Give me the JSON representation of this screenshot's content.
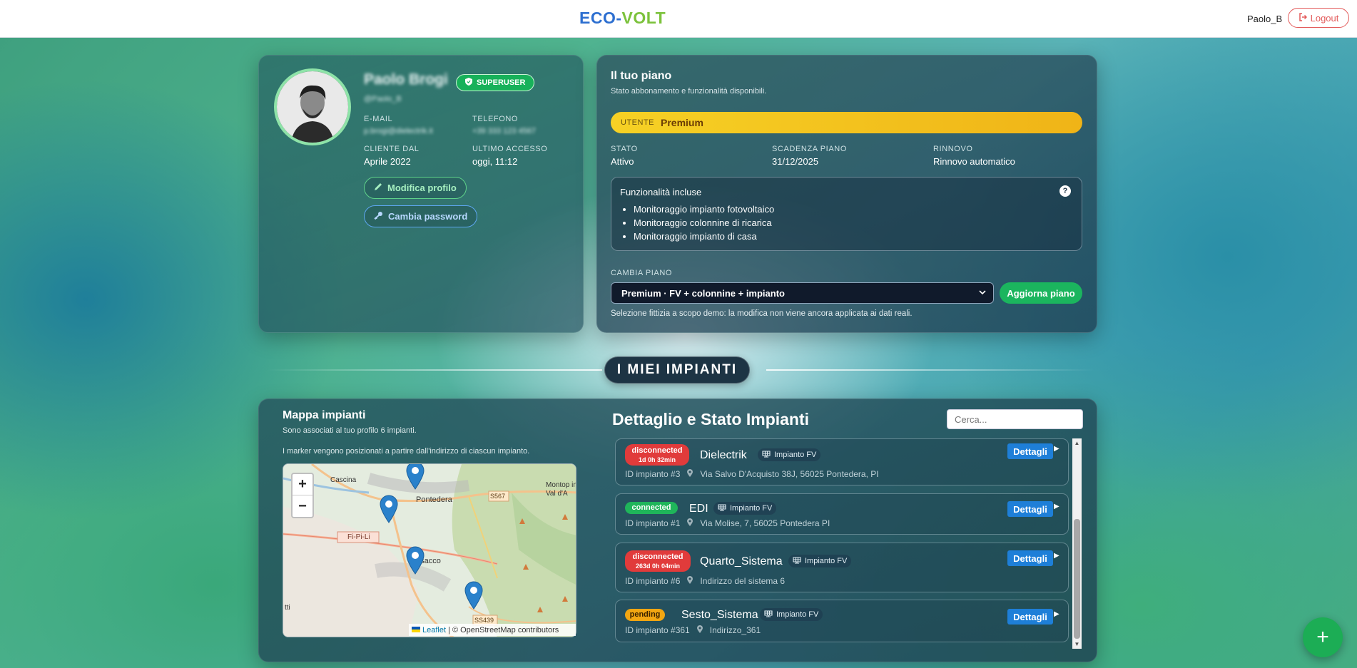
{
  "header": {
    "brand_part1": "ECO-",
    "brand_part2": "VOLT",
    "username": "Paolo_B",
    "logout_label": "Logout"
  },
  "profile": {
    "name": "Paolo Brogi",
    "role_badge": "SUPERUSER",
    "handle": "@Paolo_B",
    "email_label": "E-MAIL",
    "email": "p.brogi@dielectrik.it",
    "phone_label": "TELEFONO",
    "phone": "+39 333 123 4567",
    "client_since_label": "CLIENTE DAL",
    "client_since": "Aprile 2022",
    "last_access_label": "ULTIMO ACCESSO",
    "last_access": "oggi, 11:12",
    "edit_profile_label": "Modifica profilo",
    "change_password_label": "Cambia password"
  },
  "plan": {
    "title": "Il tuo piano",
    "subtitle": "Stato abbonamento e funzionalità disponibili.",
    "user_label": "UTENTE",
    "user_plan": "Premium",
    "status_label": "STATO",
    "status": "Attivo",
    "expiry_label": "SCADENZA PIANO",
    "expiry": "31/12/2025",
    "renewal_label": "RINNOVO",
    "renewal": "Rinnovo automatico",
    "features_title": "Funzionalità incluse",
    "features": [
      "Monitoraggio impianto fotovoltaico",
      "Monitoraggio colonnine di ricarica",
      "Monitoraggio impianto di casa"
    ],
    "change_label": "CAMBIA PIANO",
    "selected_option": "Premium · FV + colonnine + impianto",
    "update_label": "Aggiorna piano",
    "note": "Selezione fittizia a scopo demo: la modifica non viene ancora applicata ai dati reali."
  },
  "section_title": "I MIEI IMPIANTI",
  "map": {
    "title": "Mappa impianti",
    "subtitle1": "Sono associati al tuo profilo 6 impianti.",
    "subtitle2": "I marker vengono posizionati a partire dall'indirizzo di ciascun impianto.",
    "zoom_in": "+",
    "zoom_out": "−",
    "places": [
      "Cascina",
      "Pontedera",
      "S567",
      "Montop in Val d'A",
      "Fi-Pi-Li",
      "nsacco",
      "SS439",
      "tti"
    ],
    "attribution_leaflet": "Leaflet",
    "attribution_rest": "| © OpenStreetMap contributors"
  },
  "details": {
    "title": "Dettaglio e Stato Impianti",
    "search_placeholder": "Cerca...",
    "button_label": "Dettagli",
    "rows": [
      {
        "status": "disconnected",
        "duration": "1d 0h 32min",
        "name": "Dielectrik",
        "type": "Impianto FV",
        "id": "ID impianto #3",
        "address": "Via Salvo D'Acquisto 38J, 56025 Pontedera, PI"
      },
      {
        "status": "connected",
        "duration": "",
        "name": "EDI",
        "type": "Impianto FV",
        "id": "ID impianto #1",
        "address": "Via Molise, 7, 56025 Pontedera PI"
      },
      {
        "status": "disconnected",
        "duration": "263d 0h 04min",
        "name": "Quarto_Sistema",
        "type": "Impianto FV",
        "id": "ID impianto #6",
        "address": "Indirizzo del sistema 6"
      },
      {
        "status": "pending",
        "duration": "",
        "name": "Sesto_Sistema",
        "type": "Impianto FV",
        "id": "ID impianto #361",
        "address": "Indirizzo_361"
      }
    ]
  },
  "fab_label": "+"
}
